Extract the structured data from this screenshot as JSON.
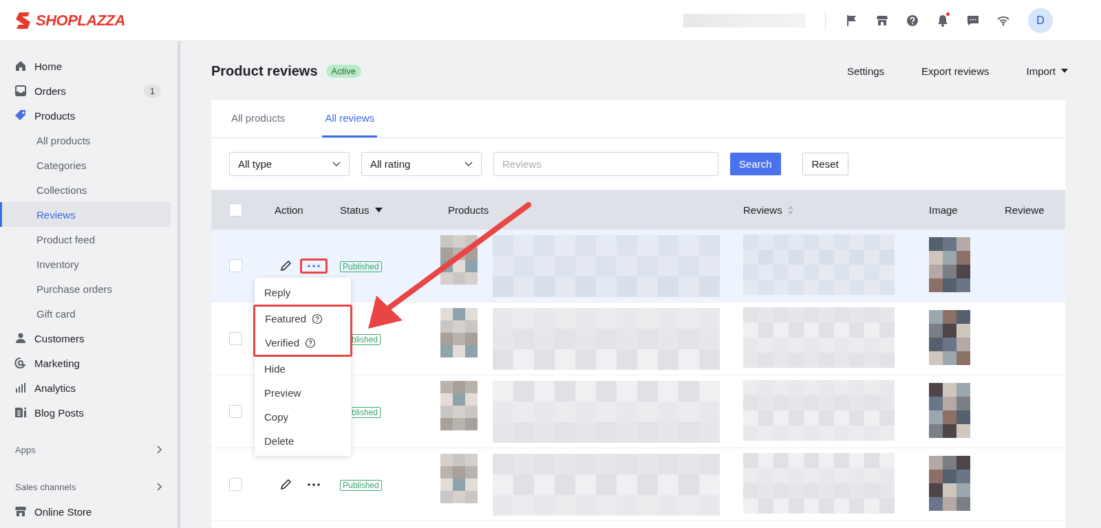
{
  "header": {
    "logo": "SHOPLAZZA",
    "icons": [
      {
        "kind": "flag",
        "dot": false
      },
      {
        "kind": "store",
        "dot": false
      },
      {
        "kind": "help",
        "dot": false
      },
      {
        "kind": "bell",
        "dot": true
      },
      {
        "kind": "chat",
        "dot": false
      },
      {
        "kind": "wifi",
        "dot": false
      }
    ],
    "avatar": "D"
  },
  "sidebar": {
    "items": [
      {
        "label": "Home",
        "kind": "home",
        "selected": false
      },
      {
        "label": "Orders",
        "kind": "inbox",
        "badge": "1",
        "selected": false
      },
      {
        "label": "Products",
        "kind": "tag",
        "selected": false,
        "children": [
          {
            "label": "All products",
            "selected": false
          },
          {
            "label": "Categories",
            "selected": false
          },
          {
            "label": "Collections",
            "selected": false
          },
          {
            "label": "Reviews",
            "selected": true
          },
          {
            "label": "Product feed",
            "selected": false
          },
          {
            "label": "Inventory",
            "selected": false
          },
          {
            "label": "Purchase orders",
            "selected": false
          },
          {
            "label": "Gift card",
            "selected": false
          }
        ]
      },
      {
        "label": "Customers",
        "kind": "person",
        "selected": false
      },
      {
        "label": "Marketing",
        "kind": "marketing",
        "selected": false
      },
      {
        "label": "Analytics",
        "kind": "bars",
        "selected": false
      },
      {
        "label": "Blog Posts",
        "kind": "blog",
        "selected": false
      }
    ],
    "sections": [
      "Apps",
      "Sales channels"
    ],
    "footer_item": {
      "label": "Online Store",
      "kind": "store"
    }
  },
  "page": {
    "title": "Product reviews",
    "status": "Active",
    "actions": [
      {
        "label": "Settings",
        "dropdown": false
      },
      {
        "label": "Export reviews",
        "dropdown": false
      },
      {
        "label": "Import",
        "dropdown": true
      }
    ]
  },
  "tabs": [
    {
      "label": "All products",
      "selected": false
    },
    {
      "label": "All reviews",
      "selected": true
    }
  ],
  "filters": {
    "type": "All type",
    "rating": "All rating",
    "search": {
      "placeholder": "Reviews"
    },
    "buttons": [
      {
        "label": "Search",
        "kind": "primary"
      },
      {
        "label": "Reset",
        "kind": "default"
      }
    ]
  },
  "table": {
    "columns": [
      {
        "label": "Action"
      },
      {
        "label": "Status",
        "kind": "filter"
      },
      {
        "label": "Products"
      },
      {
        "label": "Reviews",
        "kind": "sort"
      },
      {
        "label": "Image"
      },
      {
        "label": "Reviewe"
      }
    ],
    "all_checked": false,
    "rows": [
      {
        "checked": false,
        "status": "Published",
        "highlighted": true,
        "menu_open": true
      },
      {
        "checked": false,
        "status": "blished",
        "highlighted": false,
        "menu_open": false
      },
      {
        "checked": false,
        "status": "blished",
        "highlighted": false,
        "menu_open": false
      },
      {
        "checked": false,
        "status": "Published",
        "highlighted": false,
        "menu_open": false
      }
    ]
  },
  "menu": {
    "items": [
      {
        "label": "Reply",
        "help": false,
        "annotated": false
      },
      {
        "label": "Featured",
        "help": true,
        "annotated": true
      },
      {
        "label": "Verified",
        "help": true,
        "annotated": true
      },
      {
        "label": "Hide",
        "help": false,
        "annotated": false
      },
      {
        "label": "Preview",
        "help": false,
        "annotated": false
      },
      {
        "label": "Copy",
        "help": false,
        "annotated": false
      },
      {
        "label": "Delete",
        "help": false,
        "annotated": false
      }
    ]
  }
}
